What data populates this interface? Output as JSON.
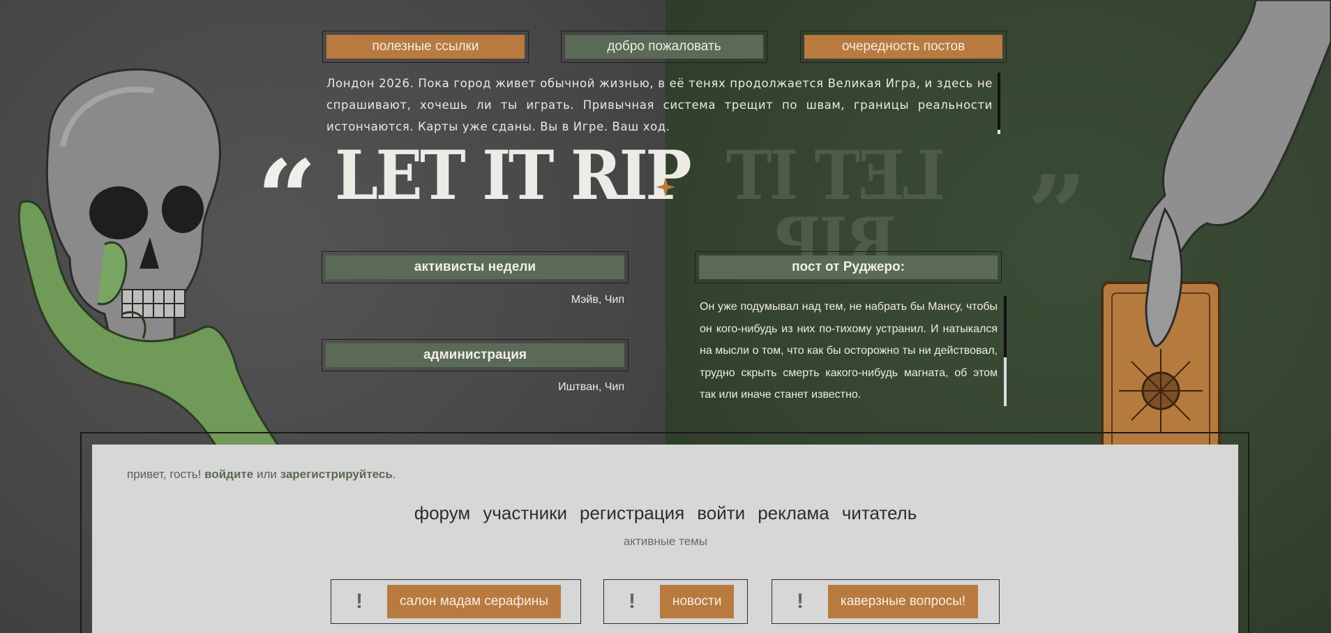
{
  "top_nav": {
    "useful_links": "полезные ссылки",
    "welcome": "добро пожаловать",
    "post_order": "очередность постов"
  },
  "intro_text": "Лондон 2026. Пока город живет обычной жизнью, в её тенях продолжается Великая Игра, и здесь не спрашивают, хочешь ли ты играть. Привычная система трещит по швам, границы реальности истончаются. Карты уже сданы. Вы в Игре. Ваш ход.",
  "title": {
    "open_quote": "“",
    "main": "LET IT RIP",
    "mirror": "LET IT RIP",
    "close_quote": "”"
  },
  "week_activists": {
    "label": "активисты недели",
    "names": "Мэйв, Чип"
  },
  "administration": {
    "label": "администрация",
    "names": "Иштван, Чип"
  },
  "featured_post": {
    "label": "пост от Руджеро:",
    "text": "Он уже подумывал над тем, не набрать бы Мансу, чтобы он кого-нибудь из них по-тихому устранил. И натыкался на мысли о том, что как бы осторожно ты ни действовал, трудно скрыть смерть какого-нибудь магната, об этом так или иначе станет известно."
  },
  "greeting": {
    "prefix": "привет, гость!",
    "login": "войдите",
    "or": "или",
    "register": "зарегистрируйтесь",
    "suffix": "."
  },
  "main_nav": {
    "forum": "форум",
    "members": "участники",
    "registration": "регистрация",
    "login": "войти",
    "ads": "реклама",
    "reader": "читатель"
  },
  "active_topics_label": "активные темы",
  "topics": [
    {
      "mark": "!",
      "label": "салон мадам серафины"
    },
    {
      "mark": "!",
      "label": "новости"
    },
    {
      "mark": "!",
      "label": "каверзные вопросы!"
    }
  ],
  "icons": {
    "skull": "skull-in-hand-illustration",
    "tarot": "tarot-card-sun-illustration",
    "sparkle": "four-point-star-icon"
  },
  "colors": {
    "accent_orange": "#b87a3f",
    "sage": "#5b6a56",
    "dark_green": "#34432f",
    "dark_gray": "#474747"
  }
}
